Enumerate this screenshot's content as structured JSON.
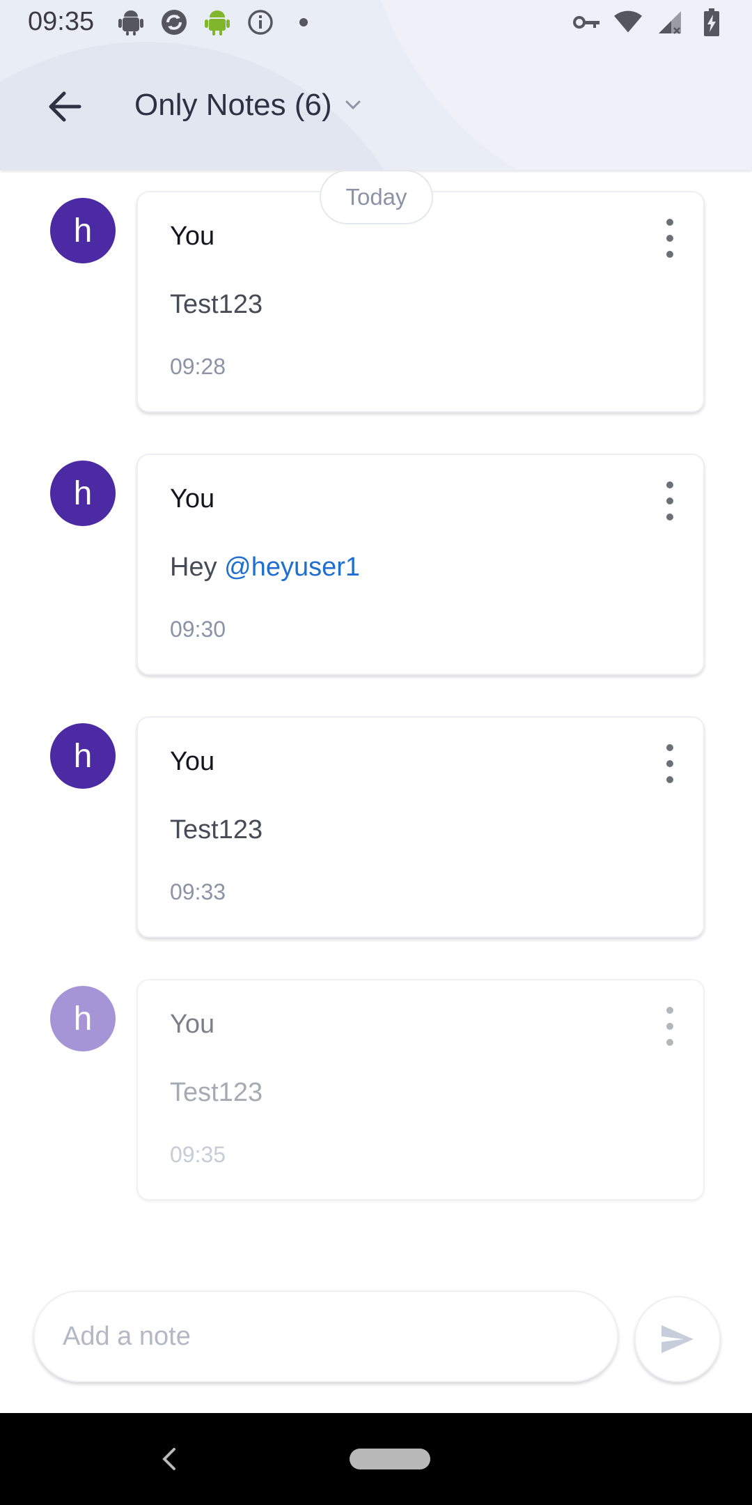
{
  "status_bar": {
    "time": "09:35",
    "left_icons": [
      "android-debug-icon",
      "sync-icon",
      "android-icon",
      "info-icon",
      "dot-icon"
    ],
    "right_icons": [
      "vpn-key-icon",
      "wifi-icon",
      "cell-signal-icon",
      "battery-charging-icon"
    ]
  },
  "app_bar": {
    "title": "Only Notes (6)",
    "back_icon": "arrow-back-icon",
    "dropdown_icon": "chevron-down-icon"
  },
  "date_separator": "Today",
  "notes": [
    {
      "avatar_letter": "h",
      "author": "You",
      "text": "Test123",
      "mention": "",
      "time": "09:28",
      "pending": false
    },
    {
      "avatar_letter": "h",
      "author": "You",
      "text": "Hey ",
      "mention": "@heyuser1",
      "time": "09:30",
      "pending": false
    },
    {
      "avatar_letter": "h",
      "author": "You",
      "text": "Test123",
      "mention": "",
      "time": "09:33",
      "pending": false
    },
    {
      "avatar_letter": "h",
      "author": "You",
      "text": "Test123",
      "mention": "",
      "time": "09:35",
      "pending": true
    }
  ],
  "composer": {
    "placeholder": "Add a note",
    "value": "",
    "send_icon": "send-icon"
  },
  "colors": {
    "avatar": "#4b2aa3",
    "avatar_pending": "#a695d6",
    "mention": "#1f6fd1",
    "header_bg": "#e9edf6"
  }
}
